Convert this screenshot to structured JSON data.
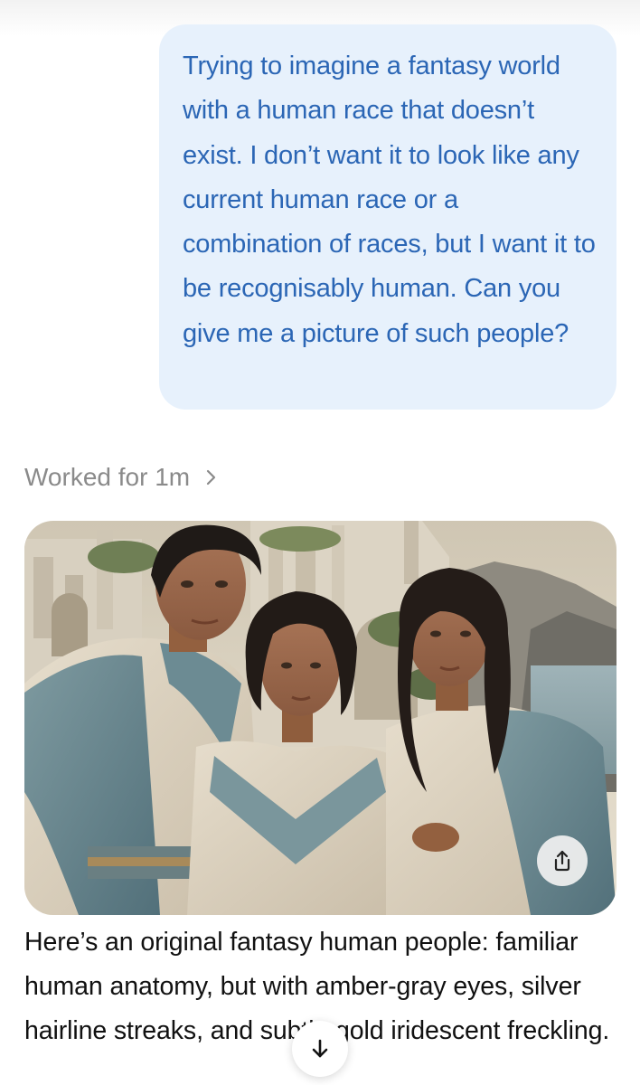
{
  "user_message": {
    "text": "Trying to imagine a fantasy world with a human race that doesn’t exist. I don’t want it to look like any current human race or a combination of races, but I want it to be recognisably human. Can you give me a picture of such people?"
  },
  "status": {
    "worked_label": "Worked for 1m",
    "chevron_icon": "chevron-right-icon"
  },
  "generated_image": {
    "share_icon": "share-icon"
  },
  "assistant_message": {
    "text": "Here’s an original fantasy human people: familiar human anatomy, but with amber-gray eyes, silver hairline streaks, and subtle gold iridescent freckling."
  },
  "scroll_button": {
    "icon": "arrow-down-icon"
  },
  "colors": {
    "user_bubble_bg": "#e7f1fc",
    "user_text": "#2b66b5",
    "muted_text": "#8a8a8a",
    "body_text": "#111111"
  }
}
